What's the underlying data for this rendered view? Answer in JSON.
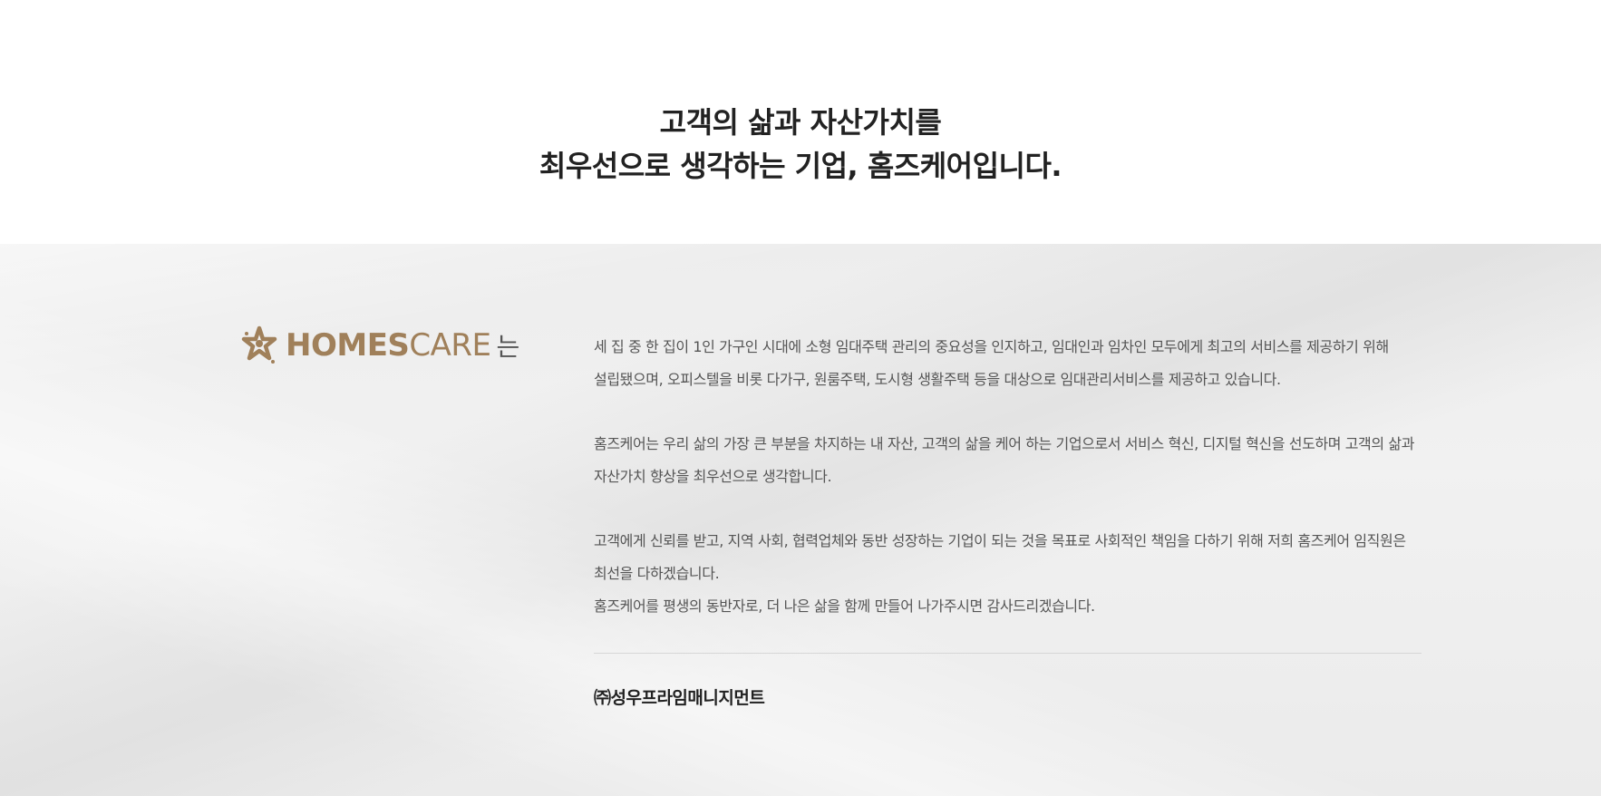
{
  "hero": {
    "line1": "고객의 삶과 자산가치를",
    "line2": "최우선으로 생각하는 기업, 홈즈케어입니다."
  },
  "brand": {
    "logo_icon": "star-logo-icon",
    "name_bold": "HOMES",
    "name_light": "CARE",
    "suffix": "는",
    "color": "#a0805a"
  },
  "intro": {
    "p1": [
      "세 집 중 한 집이 1인 가구인 시대에 소형 임대주택 관리의 중요성을 인지하고, 임대인과 임차인 모두에게 최고의 서비스를 제공하기 위해",
      "설립됐으며, 오피스텔을 비롯 다가구, 원룸주택, 도시형 생활주택 등을 대상으로 임대관리서비스를 제공하고 있습니다."
    ],
    "p2": [
      "홈즈케어는 우리 삶의 가장 큰 부분을 차지하는 내 자산, 고객의 삶을 케어 하는 기업으로서 서비스 혁신, 디지털 혁신을 선도하며 고객의 삶과",
      "자산가치 향상을 최우선으로 생각합니다."
    ],
    "p3": [
      "고객에게 신뢰를 받고, 지역 사회, 협력업체와 동반 성장하는 기업이 되는 것을 목표로 사회적인 책임을 다하기 위해 저희 홈즈케어 임직원은",
      "최선을 다하겠습니다."
    ],
    "p4": [
      "홈즈케어를 평생의 동반자로, 더 나은 삶을 함께 만들어 나가주시면 감사드리겠습니다."
    ]
  },
  "company": {
    "name": "㈜성우프라임매니지먼트"
  }
}
